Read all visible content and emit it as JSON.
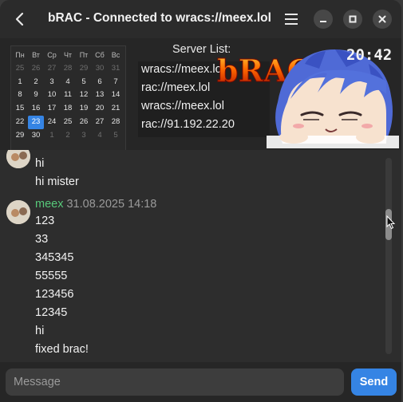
{
  "window": {
    "title": "bRAC - Connected to wracs://meex.lol"
  },
  "calendar": {
    "weekdays": [
      "Пн",
      "Вт",
      "Ср",
      "Чт",
      "Пт",
      "Сб",
      "Вс"
    ],
    "days": [
      {
        "d": "25",
        "dim": true
      },
      {
        "d": "26",
        "dim": true
      },
      {
        "d": "27",
        "dim": true
      },
      {
        "d": "28",
        "dim": true
      },
      {
        "d": "29",
        "dim": true
      },
      {
        "d": "30",
        "dim": true
      },
      {
        "d": "31",
        "dim": true
      },
      {
        "d": "1"
      },
      {
        "d": "2"
      },
      {
        "d": "3"
      },
      {
        "d": "4"
      },
      {
        "d": "5"
      },
      {
        "d": "6"
      },
      {
        "d": "7"
      },
      {
        "d": "8"
      },
      {
        "d": "9"
      },
      {
        "d": "10"
      },
      {
        "d": "11"
      },
      {
        "d": "12"
      },
      {
        "d": "13"
      },
      {
        "d": "14"
      },
      {
        "d": "15"
      },
      {
        "d": "16"
      },
      {
        "d": "17"
      },
      {
        "d": "18"
      },
      {
        "d": "19"
      },
      {
        "d": "20"
      },
      {
        "d": "21"
      },
      {
        "d": "22"
      },
      {
        "d": "23",
        "today": true
      },
      {
        "d": "24"
      },
      {
        "d": "25"
      },
      {
        "d": "26"
      },
      {
        "d": "27"
      },
      {
        "d": "28"
      },
      {
        "d": "29"
      },
      {
        "d": "30"
      },
      {
        "d": "1",
        "dim": true
      },
      {
        "d": "2",
        "dim": true
      },
      {
        "d": "3",
        "dim": true
      },
      {
        "d": "4",
        "dim": true
      },
      {
        "d": "5",
        "dim": true
      }
    ]
  },
  "servers": {
    "title": "Server List:",
    "items": [
      "wracs://meex.lol",
      "rac://meex.lol",
      "wracs://meex.lol",
      "rac://91.192.22.20"
    ]
  },
  "clock": "20:42",
  "logo_text": "bRAC",
  "chat": {
    "earlier_messages": [
      "hi",
      "hi mister"
    ],
    "author": "meex",
    "timestamp": "31.08.2025 14:18",
    "messages": [
      "123",
      "33",
      "345345",
      "55555",
      "123456",
      "12345",
      "hi",
      "fixed brac!"
    ]
  },
  "composer": {
    "placeholder": "Message",
    "send_label": "Send"
  },
  "colors": {
    "accent": "#3584e4",
    "author": "#57c97a"
  }
}
